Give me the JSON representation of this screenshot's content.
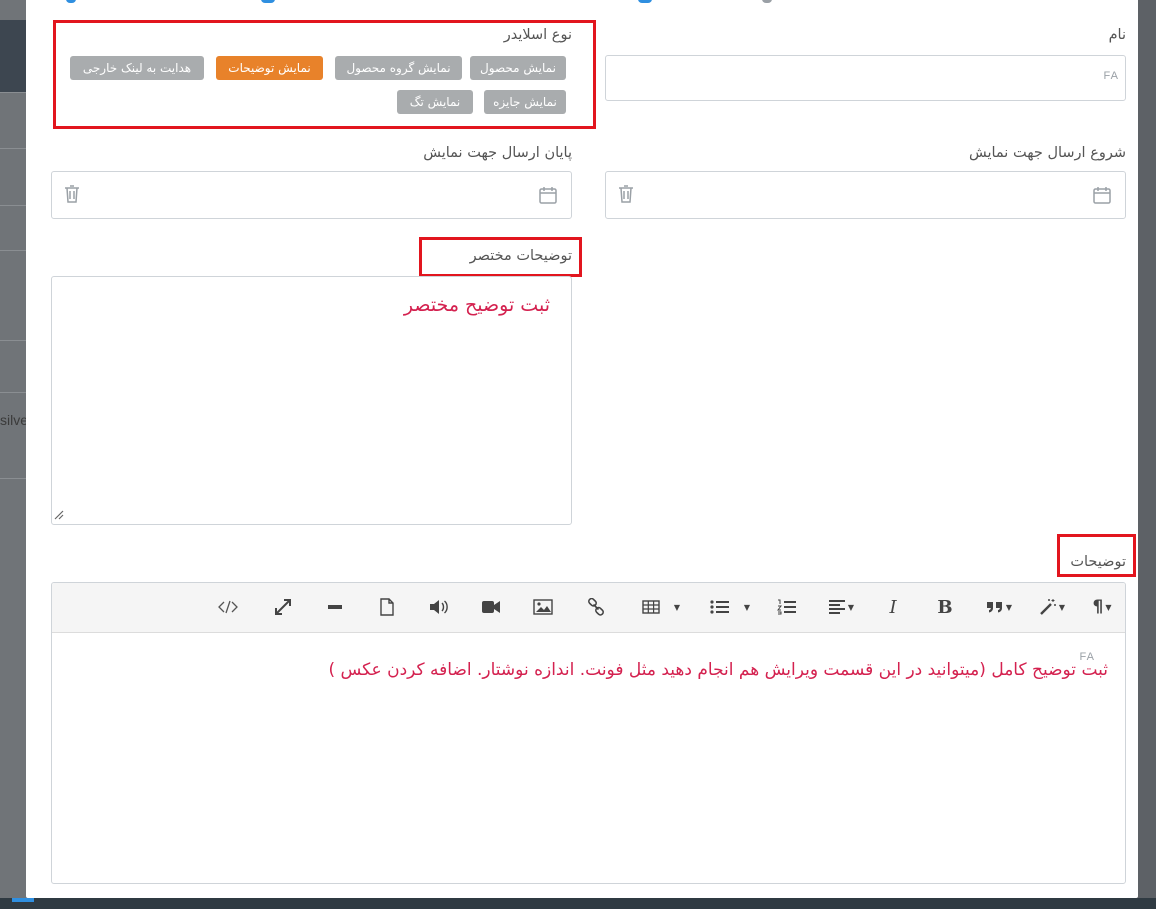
{
  "backdrop": {
    "partial_text": "silve"
  },
  "form": {
    "name": {
      "label": "نام",
      "lang": "FA"
    },
    "slider_type": {
      "label": "نوع اسلایدر",
      "options": [
        {
          "label": "نمایش محصول",
          "active": false
        },
        {
          "label": "نمایش گروه محصول",
          "active": false
        },
        {
          "label": "نمایش توضیحات",
          "active": true
        },
        {
          "label": "هدایت به لینک خارجی",
          "active": false
        },
        {
          "label": "نمایش جایزه",
          "active": false
        },
        {
          "label": "نمایش تگ",
          "active": false
        }
      ]
    },
    "start_date": {
      "label": "شروع ارسال جهت نمایش"
    },
    "end_date": {
      "label": "پایان ارسال جهت نمایش"
    },
    "short_desc": {
      "label": "توضیحات مختصر",
      "annotation": "ثبت توضیح مختصر"
    },
    "description": {
      "label": "توضیحات",
      "lang": "FA",
      "annotation": "ثبت توضیح کامل (میتوانید در این قسمت ویرایش هم انجام دهید مثل فونت. اندازه نوشتار. اضافه کردن عکس )"
    }
  },
  "toolbar_icons": [
    "code-view-icon",
    "fullscreen-icon",
    "horizontal-rule-icon",
    "file-icon",
    "audio-icon",
    "video-icon",
    "image-icon",
    "link-icon",
    "table-icon",
    "unordered-list-icon",
    "ordered-list-icon",
    "align-icon",
    "italic-icon",
    "bold-icon",
    "quote-icon",
    "magic-wand-icon",
    "paragraph-icon"
  ],
  "colors": {
    "chip_default": "#a9acae",
    "chip_active": "#e8822a",
    "annotation_red": "#e2151e",
    "annotation_text": "#d4214f"
  }
}
